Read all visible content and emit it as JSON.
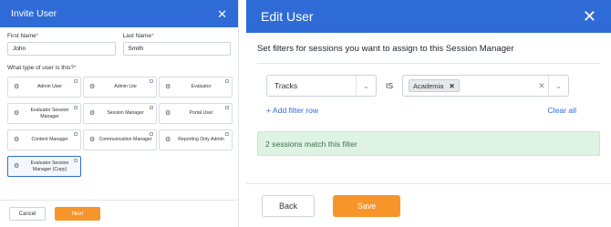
{
  "invite": {
    "title": "Invite User",
    "close_icon": "close-icon",
    "first_name_label": "First Name",
    "first_name_value": "John",
    "last_name_label": "Last Name",
    "last_name_value": "Smith",
    "required_mark": "*",
    "user_type_question": "What type of user is this?",
    "user_types": [
      {
        "label": "Admin User"
      },
      {
        "label": "Admin Lite"
      },
      {
        "label": "Evaluator"
      },
      {
        "label": "Evaluator Session Manager"
      },
      {
        "label": "Session Manager"
      },
      {
        "label": "Portal User"
      },
      {
        "label": "Content Manager"
      },
      {
        "label": "Communication Manager"
      },
      {
        "label": "Reporting Only Admin"
      },
      {
        "label": "Evaluator Session Manager (Copy)"
      }
    ],
    "selected_index": 9,
    "cancel_label": "Cancel",
    "next_label": "Next"
  },
  "edit": {
    "title": "Edit User",
    "subtitle": "Set filters for sessions you want to assign to this Session Manager",
    "filter_field": "Tracks",
    "operator": "IS",
    "selected_tag": "Academia",
    "add_filter_label": "+ Add filter row",
    "clear_all_label": "Clear all",
    "match_text": "2 sessions match this filter",
    "back_label": "Back",
    "save_label": "Save"
  },
  "colors": {
    "header_blue": "#2f6bd6",
    "accent_orange": "#f7952b",
    "match_green_bg": "#dff3e4"
  }
}
